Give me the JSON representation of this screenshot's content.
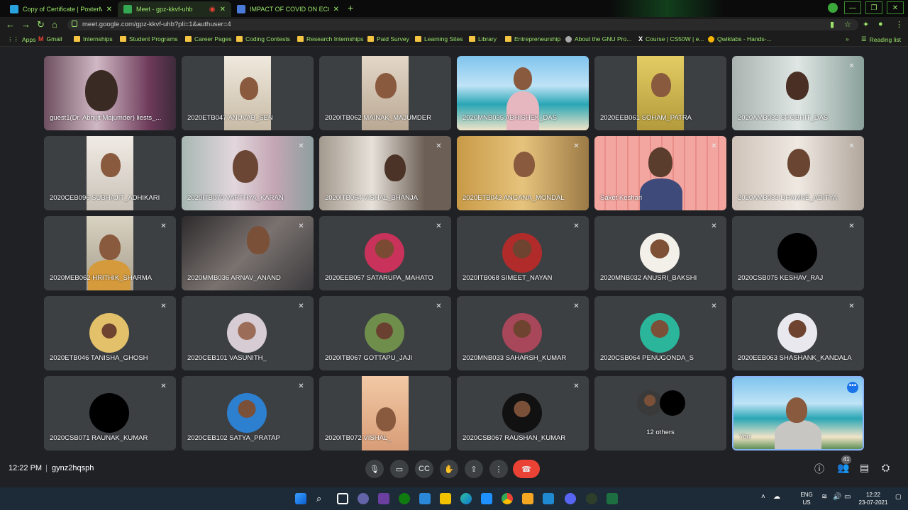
{
  "browser": {
    "tabs": [
      {
        "label": "Copy of Certificate | PosterMyWa",
        "color": "#29a3e0",
        "active": false
      },
      {
        "label": "Meet - gpz-kkvf-uhb",
        "color": "#34a853",
        "active": true
      },
      {
        "label": "IMPACT OF COVID ON ECONOMY",
        "color": "#4a7bd8",
        "active": false
      }
    ],
    "url": "meet.google.com/gpz-kkvf-uhb?pli=1&authuser=4",
    "bookmarks": [
      {
        "label": "Apps",
        "icon": "apps-grid-icon"
      },
      {
        "label": "Gmail",
        "icon": "gmail-icon"
      },
      {
        "label": "Internships",
        "icon": "folder-icon"
      },
      {
        "label": "Student Programs",
        "icon": "folder-icon"
      },
      {
        "label": "Career Pages",
        "icon": "folder-icon"
      },
      {
        "label": "Coding Contests",
        "icon": "folder-icon"
      },
      {
        "label": "Research Internships",
        "icon": "folder-icon"
      },
      {
        "label": "Paid Survey",
        "icon": "folder-icon"
      },
      {
        "label": "Learning Sites",
        "icon": "folder-icon"
      },
      {
        "label": "Library",
        "icon": "folder-icon"
      },
      {
        "label": "Entrepreneurship",
        "icon": "folder-icon"
      },
      {
        "label": "About the GNU Pro...",
        "icon": "page-icon"
      },
      {
        "label": "Course | CS50W | e...",
        "icon": "edx-icon"
      },
      {
        "label": "Qwiklabs - Hands-...",
        "icon": "qwiklabs-icon"
      }
    ],
    "reading_list": "Reading list",
    "chevron": "»"
  },
  "meet": {
    "participants": [
      "guest1(Dr. Abhijit Majumder) liests_...",
      "2020ETB047 ANUVAB_SEN",
      "2020ITB062 MAINAK_MAJUMDER",
      "2020MNB035 ABHISHEK_DAS",
      "2020EEB061 SOHAM_PATRA",
      "2020AMB032 SHOBHIT_DAS",
      "2020CEB096 SUBHAJIT_ADHIKARI",
      "2020ITB070 VARTHYA_KARAN",
      "2020ITB064 VISHAL_BHANJA",
      "2020ETB042 ANGANA_MONDAL",
      "Saket Keshari",
      "2020AMB033 DHAMNE_ADITYA",
      "2020MEB062 HRITHIK_SHARMA",
      "2020MMB036 ARNAV_ANAND",
      "2020EEB057 SATARUPA_MAHATO",
      "2020ITB068 SIMEET_NAYAN",
      "2020MNB032 ANUSRI_BAKSHI",
      "2020CSB075 KESHAV_RAJ",
      "2020ETB046 TANISHA_GHOSH",
      "2020CEB101 VASUNITH_",
      "2020ITB067 GOTTAPU_JAJI",
      "2020MNB033 SAHARSH_KUMAR",
      "2020CSB064 PENUGONDA_S",
      "2020EEB063 SHASHANK_KANDALA",
      "2020CSB071 RAUNAK_KUMAR",
      "2020CEB102 SATYA_PRATAP",
      "2020ITB072 VISHAL_",
      "2020CSB067 RAUSHAN_KUMAR"
    ],
    "others_label": "12 others",
    "you_label": "You",
    "time": "12:22 PM",
    "separator": "|",
    "meeting_code": "gynz2hqsph",
    "participant_count": "41"
  },
  "taskbar": {
    "language": "ENG",
    "region": "US",
    "time": "12:22",
    "date": "23-07-2021"
  }
}
